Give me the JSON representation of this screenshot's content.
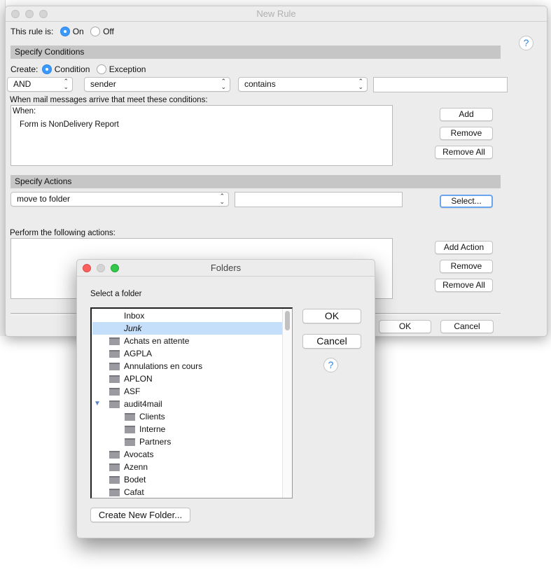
{
  "rule_window": {
    "title": "New Rule",
    "rule_is_label": "This rule is:",
    "on_label": "On",
    "off_label": "Off",
    "rule_state": "On",
    "conditions_header": "Specify Conditions",
    "create_label": "Create:",
    "condition_label": "Condition",
    "exception_label": "Exception",
    "create_selected": "Condition",
    "logic_select": "AND",
    "field_select": "sender",
    "operator_select": "contains",
    "value_input": "",
    "conditions_caption": "When mail messages arrive that meet these conditions:",
    "conditions_list": {
      "heading": "When:",
      "items": [
        "Form is NonDelivery Report"
      ]
    },
    "add_label": "Add",
    "remove_label": "Remove",
    "remove_all_label": "Remove All",
    "actions_header": "Specify Actions",
    "action_select": "move to folder",
    "action_value": "",
    "select_label": "Select...",
    "actions_caption": "Perform the following actions:",
    "add_action_label": "Add Action",
    "action_remove_label": "Remove",
    "action_remove_all_label": "Remove All",
    "ok_label": "OK",
    "cancel_label": "Cancel",
    "help_label": "?"
  },
  "folders_window": {
    "title": "Folders",
    "prompt": "Select a folder",
    "folders": [
      {
        "name": "Inbox",
        "level": 0,
        "icon": false
      },
      {
        "name": "Junk",
        "level": 0,
        "icon": false,
        "selected": true,
        "italic": true
      },
      {
        "name": "Achats en attente",
        "level": 0,
        "icon": true
      },
      {
        "name": "AGPLA",
        "level": 0,
        "icon": true
      },
      {
        "name": "Annulations en cours",
        "level": 0,
        "icon": true
      },
      {
        "name": "APLON",
        "level": 0,
        "icon": true
      },
      {
        "name": "ASF",
        "level": 0,
        "icon": true
      },
      {
        "name": "audit4mail",
        "level": 0,
        "icon": true,
        "expanded": true
      },
      {
        "name": "Clients",
        "level": 1,
        "icon": true
      },
      {
        "name": "Interne",
        "level": 1,
        "icon": true
      },
      {
        "name": "Partners",
        "level": 1,
        "icon": true
      },
      {
        "name": "Avocats",
        "level": 0,
        "icon": true
      },
      {
        "name": "Azenn",
        "level": 0,
        "icon": true
      },
      {
        "name": "Bodet",
        "level": 0,
        "icon": true
      },
      {
        "name": "Cafat",
        "level": 0,
        "icon": true
      }
    ],
    "ok_label": "OK",
    "cancel_label": "Cancel",
    "help_label": "?",
    "create_folder_label": "Create New Folder..."
  },
  "colors": {
    "accent": "#3b99fc",
    "selection": "#c5defa",
    "close": "#fc605c",
    "zoom": "#34c84a"
  }
}
